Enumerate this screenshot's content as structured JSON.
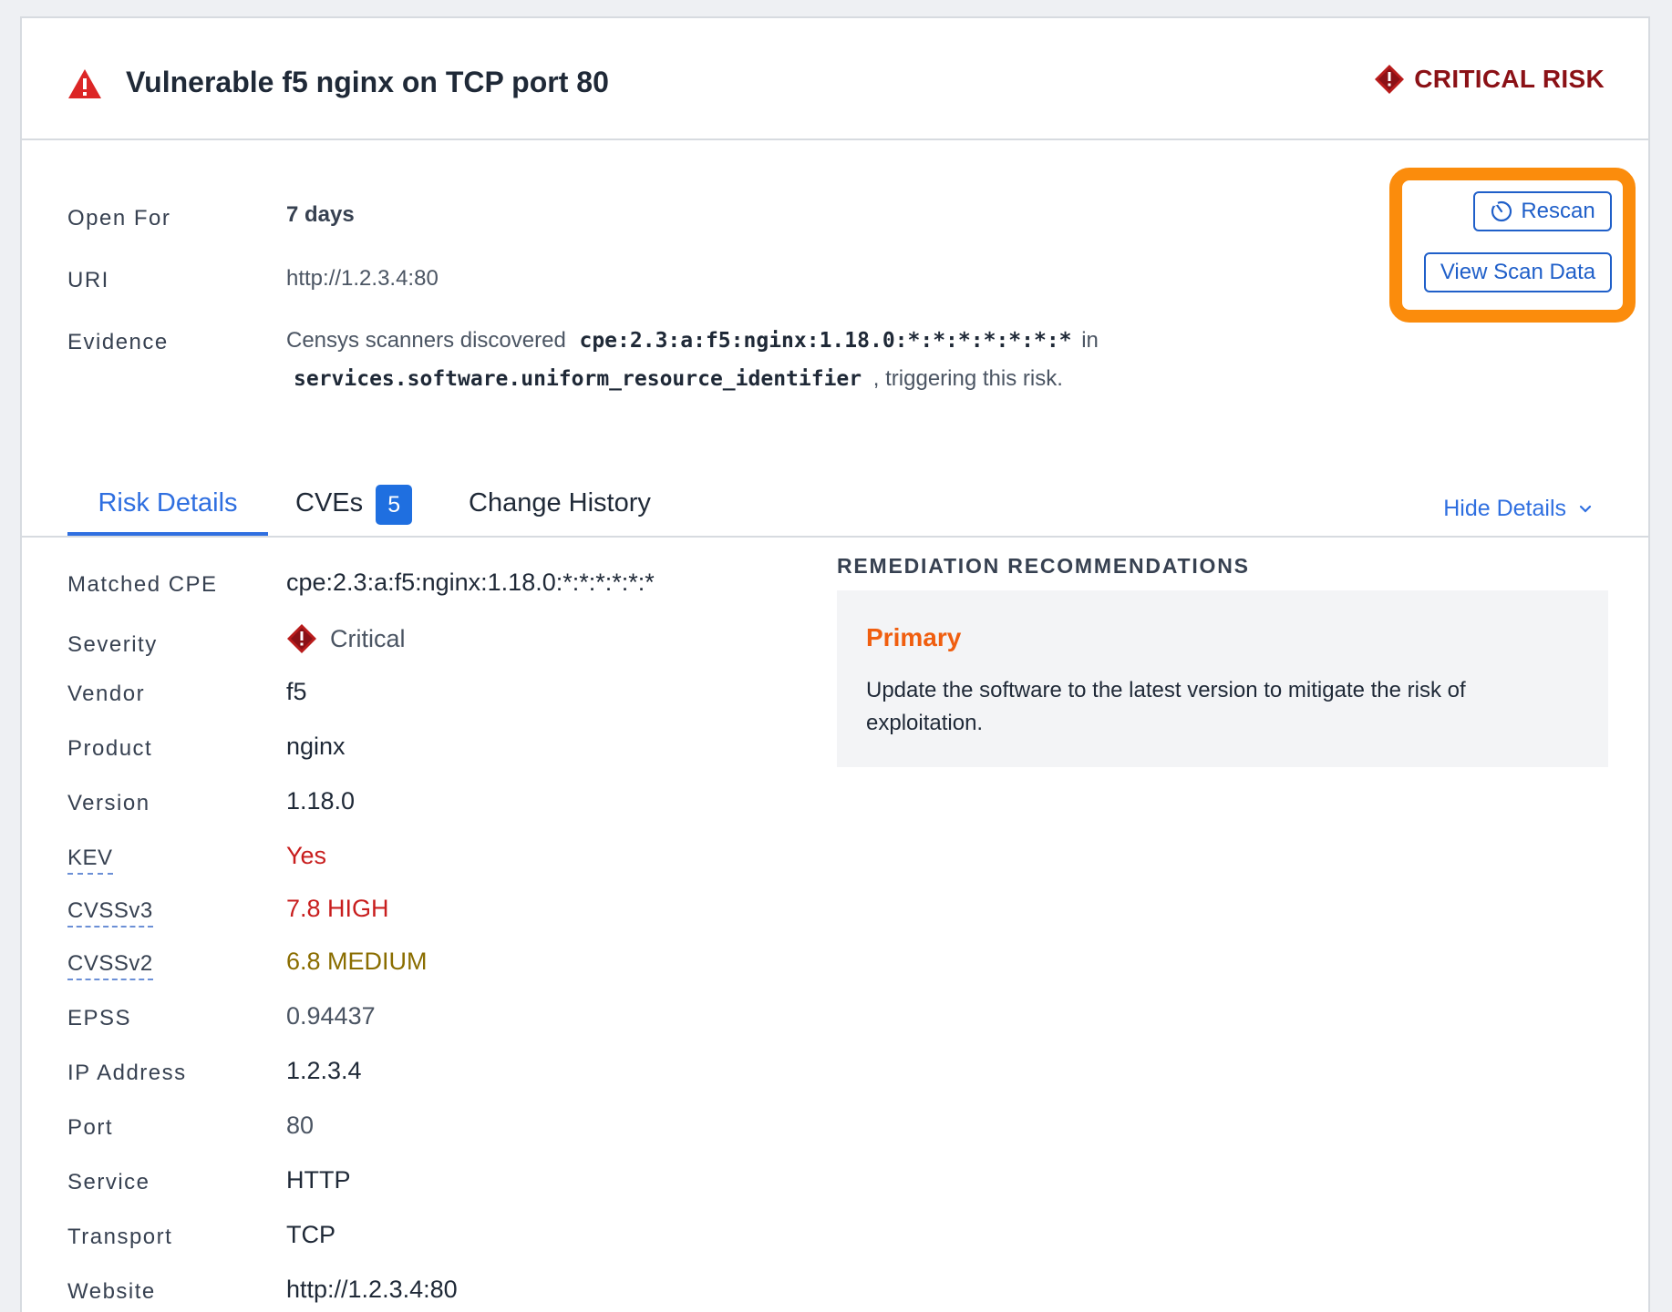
{
  "header": {
    "title": "Vulnerable f5 nginx on TCP port 80",
    "risk_label": "CRITICAL RISK"
  },
  "summary": {
    "open_for_label": "Open For",
    "open_for_value": "7 days",
    "uri_label": "URI",
    "uri_value": "http://1.2.3.4:80",
    "evidence_label": "Evidence",
    "evidence_prefix": "Censys scanners discovered",
    "evidence_cpe": "cpe:2.3:a:f5:nginx:1.18.0:*:*:*:*:*:*:*",
    "evidence_in": "in",
    "evidence_field": "services.software.uniform_resource_identifier",
    "evidence_suffix": ", triggering this risk."
  },
  "actions": {
    "rescan_label": "Rescan",
    "view_scan_label": "View Scan Data"
  },
  "tabs": {
    "risk_details": "Risk Details",
    "cves": "CVEs",
    "cves_count": "5",
    "change_history": "Change History",
    "hide_details": "Hide Details"
  },
  "details": {
    "matched_cpe_label": "Matched CPE",
    "matched_cpe_value": "cpe:2.3:a:f5:nginx:1.18.0:*:*:*:*:*:*",
    "severity_label": "Severity",
    "severity_value": "Critical",
    "vendor_label": "Vendor",
    "vendor_value": "f5",
    "product_label": "Product",
    "product_value": "nginx",
    "version_label": "Version",
    "version_value": "1.18.0",
    "kev_label": "KEV",
    "kev_value": "Yes",
    "cvss3_label": "CVSSv3",
    "cvss3_value": "7.8 HIGH",
    "cvss2_label": "CVSSv2",
    "cvss2_value": "6.8 MEDIUM",
    "epss_label": "EPSS",
    "epss_value": "0.94437",
    "ip_label": "IP Address",
    "ip_value": "1.2.3.4",
    "port_label": "Port",
    "port_value": "80",
    "service_label": "Service",
    "service_value": "HTTP",
    "transport_label": "Transport",
    "transport_value": "TCP",
    "website_label": "Website",
    "website_value": "http://1.2.3.4:80"
  },
  "remediation": {
    "title": "REMEDIATION RECOMMENDATIONS",
    "primary_label": "Primary",
    "primary_text": "Update the software to the latest version to mitigate the risk of exploitation."
  },
  "colors": {
    "accent_blue": "#2f6fe0",
    "critical_red": "#8b1116",
    "highlight_orange": "#fb8c0c",
    "primary_orange": "#f05e0f",
    "high_red": "#c81e1e",
    "medium_olive": "#8a6d00"
  }
}
